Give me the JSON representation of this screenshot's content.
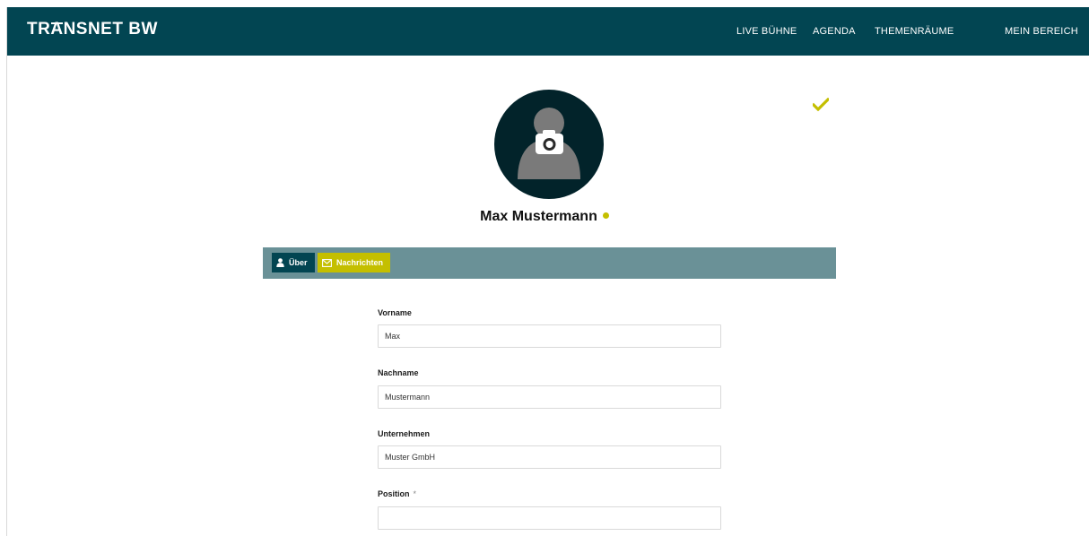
{
  "header": {
    "logo_prefix": "TR",
    "logo_mark": "A",
    "logo_suffix": "NSNET BW",
    "nav": [
      {
        "label": "LIVE BÜHNE"
      },
      {
        "label": "AGENDA"
      },
      {
        "label": "THEMENRÄUME"
      },
      {
        "label": "MEIN BEREICH"
      }
    ]
  },
  "profile": {
    "name": "Max Mustermann",
    "status": "online",
    "avatar_icon": "user-silhouette-icon",
    "upload_icon": "camera-icon",
    "saved_icon": "checkmark-icon"
  },
  "tabs": [
    {
      "label": "Über",
      "icon": "user-icon",
      "active": true
    },
    {
      "label": "Nachrichten",
      "icon": "envelope-icon",
      "active": false
    }
  ],
  "form": {
    "fields": [
      {
        "label": "Vorname",
        "value": "Max",
        "required": false
      },
      {
        "label": "Nachname",
        "value": "Mustermann",
        "required": false
      },
      {
        "label": "Unternehmen",
        "value": "Muster GmbH",
        "required": false
      },
      {
        "label": "Position",
        "value": "",
        "required": true,
        "required_mark": "*"
      }
    ]
  },
  "colors": {
    "header_bg": "#024552",
    "accent": "#c4bf00",
    "tabbar_bg": "#6a9197",
    "avatar_bg": "#02232a"
  }
}
